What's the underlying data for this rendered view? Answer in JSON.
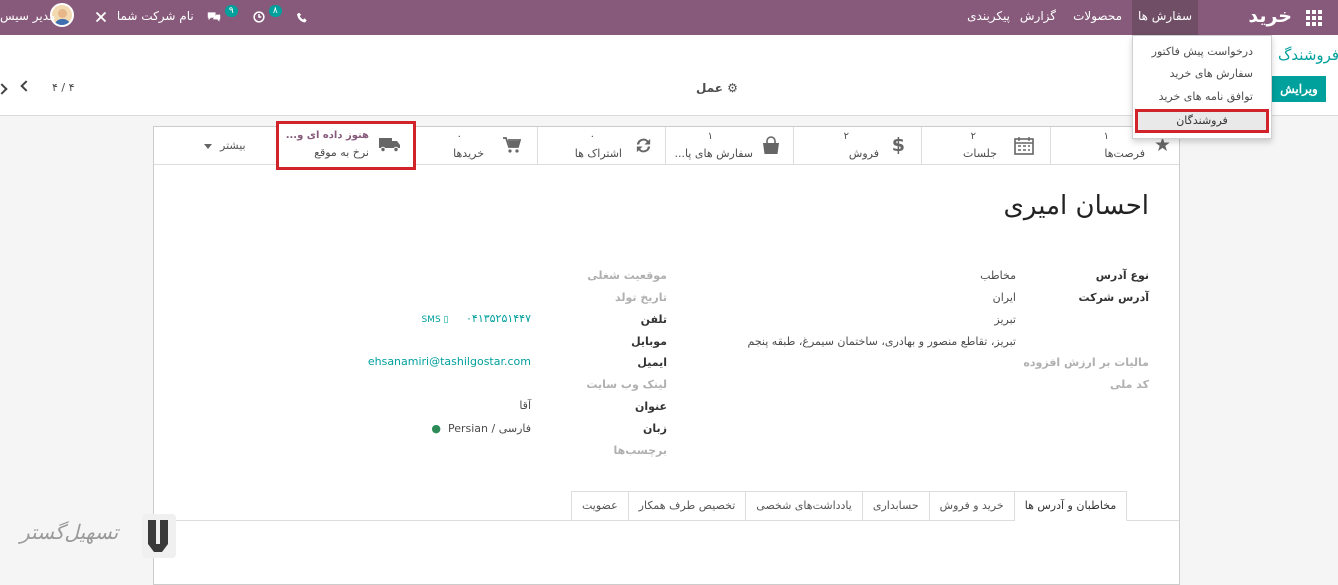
{
  "navbar": {
    "brand": "خرید",
    "apps_icon": "grid-icon",
    "menus": [
      "سفارش ها",
      "محصولات",
      "گزارش",
      "پیکربندی"
    ],
    "phone_icon": "phone-icon",
    "activity_badge": "۸",
    "messages_badge": "۹",
    "company": "نام شرکت شما",
    "user": "مدیر سیس"
  },
  "dropdown": {
    "items": [
      "درخواست پیش فاکتور",
      "سفارش های خرید",
      "توافق نامه های خرید",
      "فروشندگان"
    ]
  },
  "control": {
    "title": "فروشندگ",
    "edit_label": "ویرایش",
    "action_label": "عمل",
    "pager": "۴ / ۴"
  },
  "stat_buttons": {
    "opportunities": {
      "num": "۱",
      "label": "فرصت‌ها"
    },
    "meetings": {
      "num": "۲",
      "label": "جلسات"
    },
    "sales": {
      "num": "۲",
      "label": "فروش"
    },
    "purchase_orders": {
      "num": "۱",
      "label": "سفارش های پا..."
    },
    "subscriptions": {
      "num": "۰",
      "label": "اشتراک ها"
    },
    "purchases": {
      "num": "۰",
      "label": "خریدها"
    },
    "on_time": {
      "line1": "هنوز داده ای و...",
      "line2": "نرخ به موقع"
    },
    "more": "بیشتر"
  },
  "partner": {
    "name": "احسان امیری",
    "address_type_label": "نوع آدرس",
    "address_type_value": "مخاطب",
    "company_address_label": "آدرس شرکت",
    "country": "ایران",
    "city": "تبریز",
    "street": "تبریز، تقاطع منصور و بهادری، ساختمان سیمرغ، طبقه پنجم",
    "vat_label": "مالیات بر ارزش افزوده",
    "national_id_label": "کد ملی",
    "job_label": "موقعیت شغلی",
    "birth_label": "تاریخ تولد",
    "phone_label": "تلفن",
    "phone_value": "۰۴۱۳۵۲۵۱۴۴۷",
    "sms_label": "SMS",
    "mobile_label": "موبایل",
    "email_label": "ایمیل",
    "email_value": "ehsanamiri@tashilgostar.com",
    "website_label": "لینک وب سایت",
    "title_label": "عنوان",
    "title_value": "آقا",
    "lang_label": "زبان",
    "lang_value": "Persian / فارسی",
    "tags_label": "برچسب‌ها"
  },
  "tabs": [
    "مخاطبان و آدرس ها",
    "خرید و فروش",
    "حسابداری",
    "یادداشت‌های شخصی",
    "تخصیص طرف همکار",
    "عضویت"
  ],
  "watermark": "تسهیل‌گستر"
}
